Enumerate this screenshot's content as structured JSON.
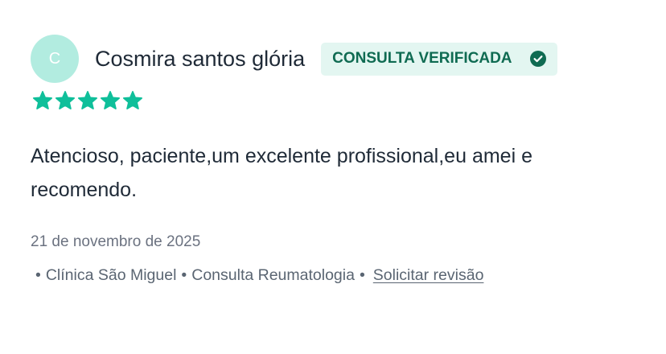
{
  "review": {
    "avatar_initial": "C",
    "author": "Cosmira santos glória",
    "badge_label": "CONSULTA VERIFICADA",
    "badge_icon": "check-circle-icon",
    "rating": 5,
    "rating_max": 5,
    "comment": "Atencioso, paciente,um excelente profissional,eu amei e recomendo.",
    "date": "21 de novembro de 2025",
    "meta": {
      "separator": "•",
      "clinic": "Clínica São Miguel",
      "consult_type": "Consulta Reumatologia",
      "request_review_link": "Solicitar revisão"
    }
  },
  "colors": {
    "star": "#0fbf9a",
    "badge_bg": "#e3f6f1",
    "badge_text": "#0f6b52",
    "avatar_bg": "#b2ece0",
    "text_primary": "#1f2a37",
    "text_secondary": "#6b7280"
  }
}
